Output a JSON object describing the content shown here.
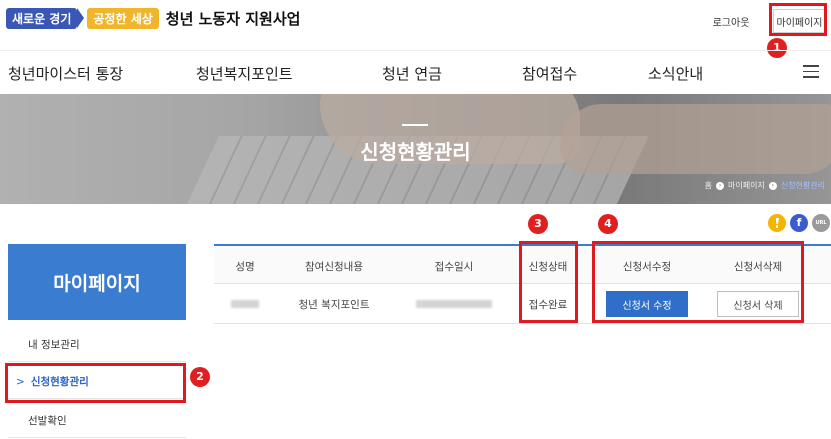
{
  "header": {
    "brand_part1": "새로운 경기",
    "brand_part2": "공정한 세상",
    "site_title": "청년 노동자 지원사업",
    "logout_label": "로그아웃",
    "mypage_label": "마이페이지"
  },
  "nav": {
    "items": [
      {
        "label": "청년마이스터 통장"
      },
      {
        "label": "청년복지포인트"
      },
      {
        "label": "청년 연금"
      },
      {
        "label": "참여접수"
      },
      {
        "label": "소식안내"
      }
    ],
    "menu_icon": "hamburger-icon"
  },
  "hero": {
    "title": "신청현황관리",
    "breadcrumb": [
      "홈",
      "마이페이지",
      "신청현황관리"
    ]
  },
  "social": [
    {
      "icon": "kakaostory-icon",
      "glyph": "",
      "color": "#f5b400"
    },
    {
      "icon": "facebook-icon",
      "glyph": "f",
      "color": "#3b5bd0"
    },
    {
      "icon": "url-share-icon",
      "glyph": "URL",
      "color": "#9a9a9a"
    }
  ],
  "sidebar": {
    "title": "마이페이지",
    "items": [
      {
        "label": "내 정보관리"
      },
      {
        "label": "신청현황관리"
      },
      {
        "label": "선발확인"
      }
    ],
    "active_marker": ">"
  },
  "table": {
    "headers": [
      "성명",
      "참여신청내용",
      "접수일시",
      "신청상태",
      "신청서수정",
      "신청서삭제"
    ],
    "row": {
      "program": "청년 복지포인트",
      "status": "접수완료",
      "edit_label": "신청서 수정",
      "delete_label": "신청서 삭제"
    }
  },
  "annotations": {
    "badge1": "1",
    "badge2": "2",
    "badge3": "3",
    "badge4": "4"
  },
  "colors": {
    "accent_blue": "#3a7cd0",
    "annotation_red": "#e0191e",
    "brand_blue": "#3a57b5",
    "brand_yellow": "#f0b52a"
  }
}
